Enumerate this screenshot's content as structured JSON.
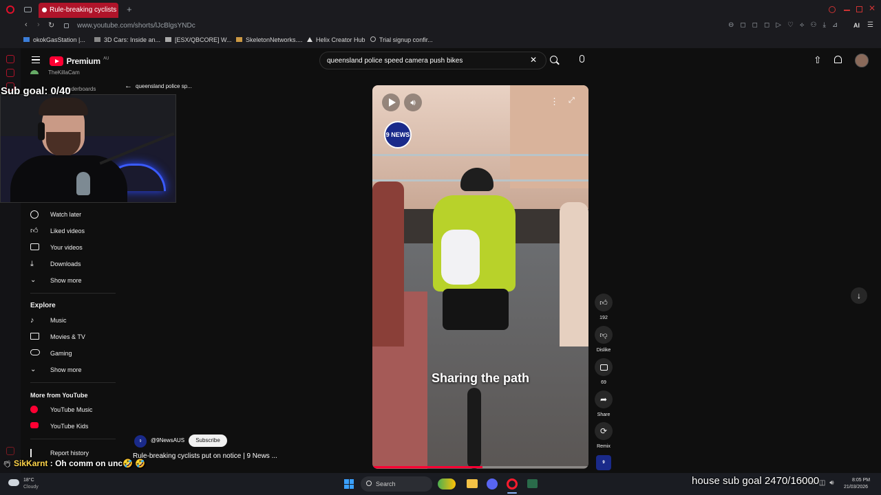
{
  "browser": {
    "tab_title": "Rule-breaking cyclists put",
    "url": "www.youtube.com/shorts/lJcBlgsYNDc",
    "bookmarks": [
      "okokGasStation |...",
      "3D Cars: Inside an...",
      "[ESX/QBCORE] W...",
      "SkeletonNetworks....",
      "Helix Creator Hub",
      "Trial signup confir..."
    ]
  },
  "youtube": {
    "logo_text": "Premium",
    "logo_region": "AU",
    "search_value": "queensland police speed camera push bikes",
    "back_label": "queensland police sp...",
    "sidebar": {
      "top_partial": "TheKillaCam",
      "top_partial2": "Leaderboards",
      "you_items": [
        {
          "label": "Watch later",
          "icon": "clock-icon"
        },
        {
          "label": "Liked videos",
          "icon": "thumbs-up-icon"
        },
        {
          "label": "Your videos",
          "icon": "play-box-icon"
        },
        {
          "label": "Downloads",
          "icon": "download-icon"
        },
        {
          "label": "Show more",
          "icon": "chevron-down-icon"
        }
      ],
      "explore_heading": "Explore",
      "explore_items": [
        {
          "label": "Music",
          "icon": "music-note-icon"
        },
        {
          "label": "Movies & TV",
          "icon": "film-icon"
        },
        {
          "label": "Gaming",
          "icon": "gamepad-icon"
        },
        {
          "label": "Show more",
          "icon": "chevron-down-icon"
        }
      ],
      "more_heading": "More from YouTube",
      "more_items": [
        {
          "label": "YouTube Music",
          "icon": "youtube-music-icon"
        },
        {
          "label": "YouTube Kids",
          "icon": "youtube-kids-icon"
        }
      ],
      "report_history": "Report history"
    },
    "short": {
      "channel_logo_text": "9 NEWS",
      "caption": "Sharing the path",
      "channel_handle": "@9NewsAUS",
      "subscribe_label": "Subscribe",
      "title": "Rule-breaking cyclists put on notice | 9 News ...",
      "actions": {
        "likes": "192",
        "dislike": "Dislike",
        "comments": "69",
        "share": "Share",
        "remix": "Remix"
      }
    }
  },
  "stream": {
    "sub_goal": "Sub goal: 0/40",
    "chat_user": "SikKarnt",
    "chat_message": ": Oh comm on unc🤣 🤣",
    "house_goal": "house sub goal 2470/16000"
  },
  "taskbar": {
    "temp": "18°C",
    "weather": "Cloudy",
    "search_placeholder": "Search",
    "time": "8:05 PM",
    "date": "21/03/2026"
  },
  "colors": {
    "accent_red": "#ff0033",
    "tab_red": "#b0142a",
    "background": "#0f0f0f"
  }
}
